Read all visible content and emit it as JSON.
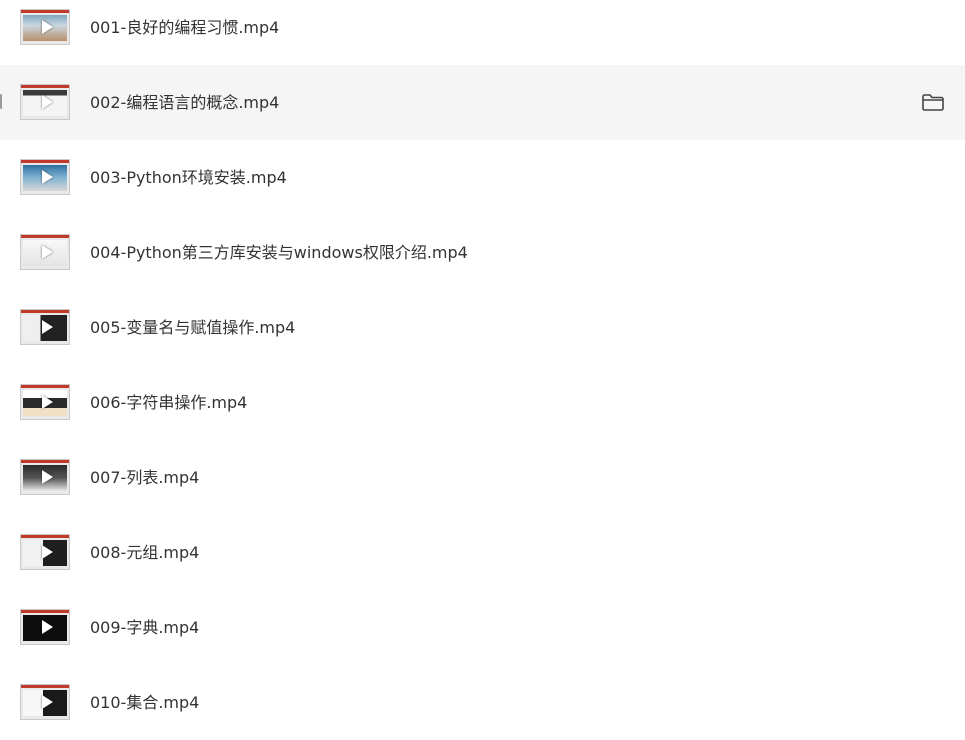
{
  "files": [
    {
      "name": "001-良好的编程习惯.mp4",
      "thumb": "v-beach"
    },
    {
      "name": "002-编程语言的概念.mp4",
      "thumb": "v-slide",
      "hovered": true
    },
    {
      "name": "003-Python环境安装.mp4",
      "thumb": "v-blue"
    },
    {
      "name": "004-Python第三方库安装与windows权限介绍.mp4",
      "thumb": "v-white"
    },
    {
      "name": "005-变量名与赋值操作.mp4",
      "thumb": "v-split"
    },
    {
      "name": "006-字符串操作.mp4",
      "thumb": "v-dark"
    },
    {
      "name": "007-列表.mp4",
      "thumb": "v-gray"
    },
    {
      "name": "008-元组.mp4",
      "thumb": "v-face"
    },
    {
      "name": "009-字典.mp4",
      "thumb": "v-black"
    },
    {
      "name": "010-集合.mp4",
      "thumb": "v-mix"
    }
  ],
  "icons": {
    "hover_action": "folder-icon",
    "thumbnail_overlay": "play-icon"
  },
  "colors": {
    "hover_background": "#f5f5f5",
    "text": "#333333"
  }
}
